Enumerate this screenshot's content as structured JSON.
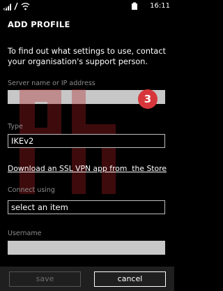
{
  "status_bar": {
    "time": "16:11",
    "icons": [
      "cellular-signal-icon",
      "mobile-data-icon",
      "wifi-icon",
      "battery-icon"
    ]
  },
  "page_title": "ADD PROFILE",
  "instructions": "To find out what settings to use, contact your organisation's support person.",
  "server": {
    "label": "Server name or IP address",
    "value": ""
  },
  "type": {
    "label": "Type",
    "value": "IKEv2"
  },
  "store_link": "Download an SSL VPN app from  the Store",
  "connect_using": {
    "label": "Connect using",
    "placeholder": "select an item"
  },
  "username": {
    "label": "Username",
    "value": ""
  },
  "callout_badge": "3",
  "watermark": "ph",
  "app_bar": {
    "save_label": "save",
    "cancel_label": "cancel"
  },
  "colors": {
    "background": "#000000",
    "field_fill": "#c7c7c7",
    "label_gray": "#8c8c8c",
    "badge_red": "#d7373b",
    "app_bar": "#1f1f1f"
  }
}
